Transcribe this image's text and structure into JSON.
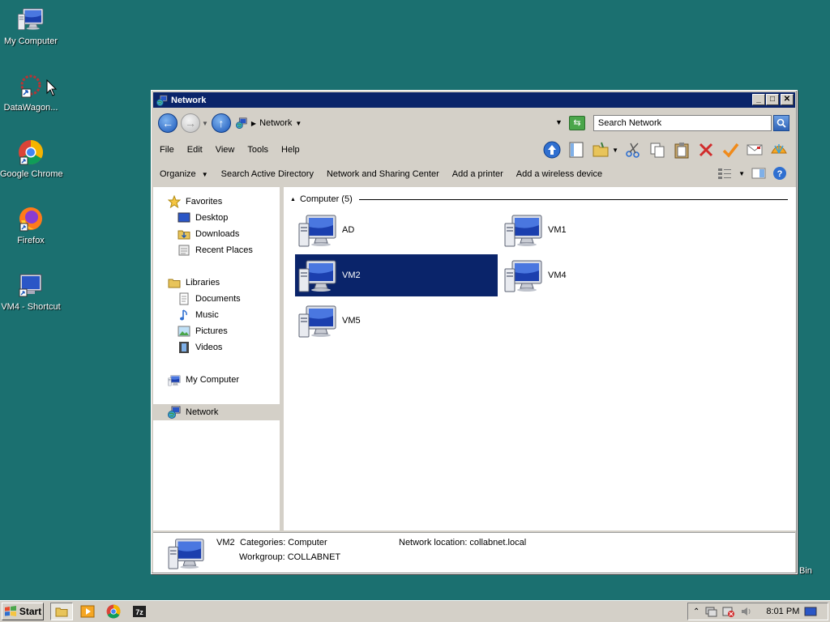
{
  "desktop": {
    "icons": [
      {
        "label": "My Computer"
      },
      {
        "label": "DataWagon..."
      },
      {
        "label": "Google Chrome"
      },
      {
        "label": "Firefox"
      },
      {
        "label": "VM4 - Shortcut"
      }
    ],
    "recycle_bin_partial": "Bin"
  },
  "window": {
    "title": "Network",
    "address": {
      "crumb": "Network"
    },
    "search_placeholder": "Search Network",
    "menu": [
      "File",
      "Edit",
      "View",
      "Tools",
      "Help"
    ],
    "commands": [
      "Organize",
      "Search Active Directory",
      "Network and Sharing Center",
      "Add a printer",
      "Add a wireless device"
    ],
    "nav": {
      "favorites": {
        "label": "Favorites",
        "items": [
          "Desktop",
          "Downloads",
          "Recent Places"
        ]
      },
      "libraries": {
        "label": "Libraries",
        "items": [
          "Documents",
          "Music",
          "Pictures",
          "Videos"
        ]
      },
      "my_computer": "My Computer",
      "network": "Network"
    },
    "group": {
      "header": "Computer (5)"
    },
    "computers": [
      "AD",
      "VM1",
      "VM2",
      "VM4",
      "VM5"
    ],
    "selected_computer": "VM2",
    "details": {
      "name": "VM2",
      "categories": "Categories: Computer",
      "workgroup": "Workgroup: COLLABNET",
      "network_location": "Network location: collabnet.local"
    }
  },
  "taskbar": {
    "start_label": "Start",
    "clock": "8:01 PM"
  },
  "colors": {
    "desktop": "#1b7070",
    "titlebar": "#0a246a",
    "selection": "#0a246a",
    "chrome": "#d4d0c8"
  }
}
